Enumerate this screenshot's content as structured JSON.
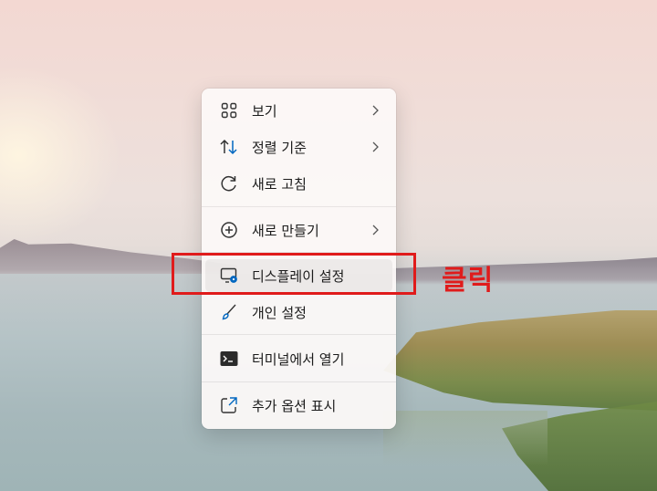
{
  "menu": {
    "items": [
      {
        "label": "보기",
        "icon": "grid-icon",
        "has_submenu": true
      },
      {
        "label": "정렬 기준",
        "icon": "sort-arrows-icon",
        "has_submenu": true
      },
      {
        "label": "새로 고침",
        "icon": "refresh-icon",
        "has_submenu": false
      },
      {
        "label": "새로 만들기",
        "icon": "add-circle-icon",
        "has_submenu": true
      },
      {
        "label": "디스플레이 설정",
        "icon": "display-settings-icon",
        "has_submenu": false
      },
      {
        "label": "개인 설정",
        "icon": "brush-icon",
        "has_submenu": false
      },
      {
        "label": "터미널에서 열기",
        "icon": "terminal-icon",
        "has_submenu": false
      },
      {
        "label": "추가 옵션 표시",
        "icon": "open-external-icon",
        "has_submenu": false
      }
    ],
    "highlighted_item": "디스플레이 설정"
  },
  "annotation": {
    "text": "클릭",
    "color": "#e01b1b"
  },
  "colors": {
    "accent": "#0067c0",
    "annotation_red": "#e01b1b"
  }
}
